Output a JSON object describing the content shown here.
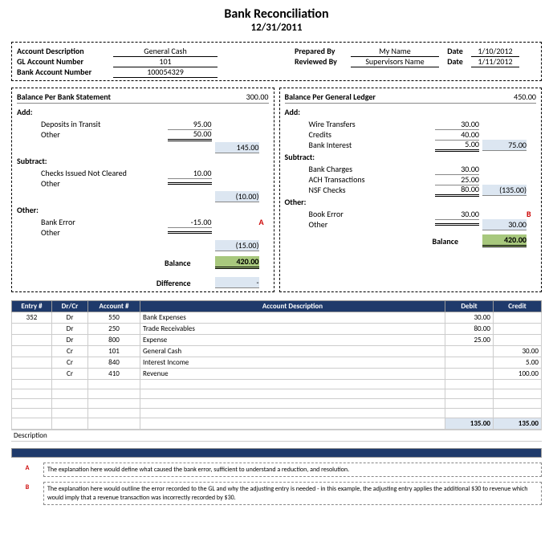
{
  "title": "Bank Reconciliation",
  "date": "12/31/2011",
  "header": {
    "acct_desc_lbl": "Account Description",
    "acct_desc": "General Cash",
    "gl_num_lbl": "GL Account Number",
    "gl_num": "101",
    "bank_num_lbl": "Bank Account Number",
    "bank_num": "100054329",
    "prep_lbl": "Prepared By",
    "prep": "My Name",
    "rev_lbl": "Reviewed By",
    "rev": "Supervisors Name",
    "date_lbl": "Date",
    "prep_date": "1/10/2012",
    "rev_date": "1/11/2012"
  },
  "bank": {
    "title": "Balance Per Bank Statement",
    "opening": "300.00",
    "add_lbl": "Add:",
    "add": [
      {
        "lbl": "Deposits in Transit",
        "val": "95.00"
      },
      {
        "lbl": "Other",
        "val": "50.00"
      }
    ],
    "add_sub": "145.00",
    "sub_lbl": "Subtract:",
    "sub": [
      {
        "lbl": "Checks Issued Not Cleared",
        "val": "10.00"
      },
      {
        "lbl": "Other",
        "val": ""
      }
    ],
    "sub_sub": "(10.00)",
    "other_lbl": "Other:",
    "other": [
      {
        "lbl": "Bank Error",
        "val": "-15.00",
        "tag": "A"
      },
      {
        "lbl": "Other",
        "val": ""
      }
    ],
    "other_sub": "(15.00)",
    "bal_lbl": "Balance",
    "bal": "420.00",
    "diff_lbl": "Difference",
    "diff": "-"
  },
  "ledger": {
    "title": "Balance Per General Ledger",
    "opening": "450.00",
    "add_lbl": "Add:",
    "add": [
      {
        "lbl": "Wire Transfers",
        "val": "30.00"
      },
      {
        "lbl": "Credits",
        "val": "40.00"
      },
      {
        "lbl": "Bank Interest",
        "val": "5.00"
      }
    ],
    "add_sub": "75.00",
    "sub_lbl": "Subtract:",
    "sub": [
      {
        "lbl": "Bank Charges",
        "val": "30.00"
      },
      {
        "lbl": "ACH Transactions",
        "val": "25.00"
      },
      {
        "lbl": "NSF Checks",
        "val": "80.00"
      }
    ],
    "sub_sub": "(135.00)",
    "other_lbl": "Other:",
    "other": [
      {
        "lbl": "Book Error",
        "val": "30.00",
        "tag": "B"
      },
      {
        "lbl": "Other",
        "val": ""
      }
    ],
    "other_sub": "30.00",
    "bal_lbl": "Balance",
    "bal": "420.00"
  },
  "table": {
    "headers": [
      "Entry #",
      "Dr/Cr",
      "Account #",
      "Account Description",
      "Debit",
      "Credit"
    ],
    "rows": [
      {
        "entry": "352",
        "drcr": "Dr",
        "acct": "550",
        "desc": "Bank Expenses",
        "debit": "30.00",
        "credit": ""
      },
      {
        "entry": "",
        "drcr": "Dr",
        "acct": "250",
        "desc": "Trade Receivables",
        "debit": "80.00",
        "credit": ""
      },
      {
        "entry": "",
        "drcr": "Dr",
        "acct": "800",
        "desc": "Expense",
        "debit": "25.00",
        "credit": ""
      },
      {
        "entry": "",
        "drcr": "Cr",
        "acct": "101",
        "desc": "General Cash",
        "debit": "",
        "credit": "30.00"
      },
      {
        "entry": "",
        "drcr": "Cr",
        "acct": "840",
        "desc": "Interest Income",
        "debit": "",
        "credit": "5.00"
      },
      {
        "entry": "",
        "drcr": "Cr",
        "acct": "410",
        "desc": "Revenue",
        "debit": "",
        "credit": "100.00"
      }
    ],
    "tot_debit": "135.00",
    "tot_credit": "135.00",
    "desc_lbl": "Description"
  },
  "notes": [
    {
      "tag": "A",
      "txt": "The explanation here would define what caused the bank error, sufficient to understand a reduction, and resolution."
    },
    {
      "tag": "B",
      "txt": "The explanation here would outline the error recorded to the GL and why the adjusting entry is needed - in this example, the adjusting entry applies the additional $30 to revenue which would imply that a revenue transaction was incorrectly recorded by $30."
    }
  ]
}
